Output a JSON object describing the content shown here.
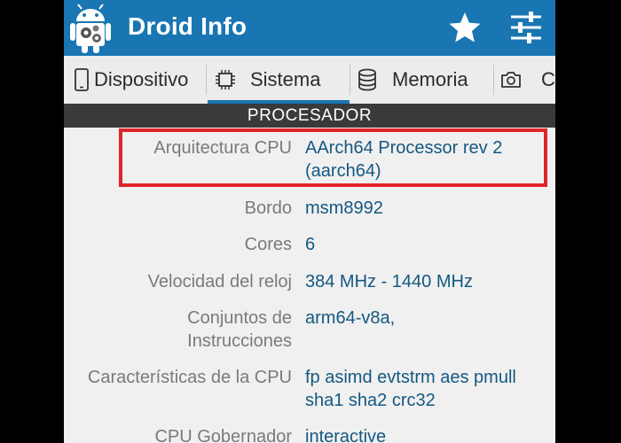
{
  "app": {
    "title": "Droid Info"
  },
  "tabs": [
    {
      "label": "Dispositivo",
      "icon": "phone-icon",
      "selected": false
    },
    {
      "label": "Sistema",
      "icon": "chip-icon",
      "selected": true
    },
    {
      "label": "Memoria",
      "icon": "database-icon",
      "selected": false
    },
    {
      "label": "Cá",
      "icon": "camera-icon",
      "selected": false
    }
  ],
  "section": {
    "title": "PROCESADOR"
  },
  "rows": [
    {
      "label": "Arquitectura CPU",
      "value": "AArch64 Processor rev 2 (aarch64)"
    },
    {
      "label": "Bordo",
      "value": "msm8992"
    },
    {
      "label": "Cores",
      "value": "6"
    },
    {
      "label": "Velocidad del reloj",
      "value": "384 MHz - 1440 MHz"
    },
    {
      "label": "Conjuntos de Instrucciones",
      "value": "arm64-v8a,"
    },
    {
      "label": "Características de la CPU",
      "value": "fp asimd evtstrm aes pmull sha1 sha2 crc32"
    },
    {
      "label": "CPU Gobernador",
      "value": "interactive"
    }
  ],
  "colors": {
    "accent": "#1976b3",
    "highlight": "#e0242a",
    "value_text": "#145882",
    "label_text": "#7a7a7a",
    "section_header_bg": "#3a3a3a"
  }
}
